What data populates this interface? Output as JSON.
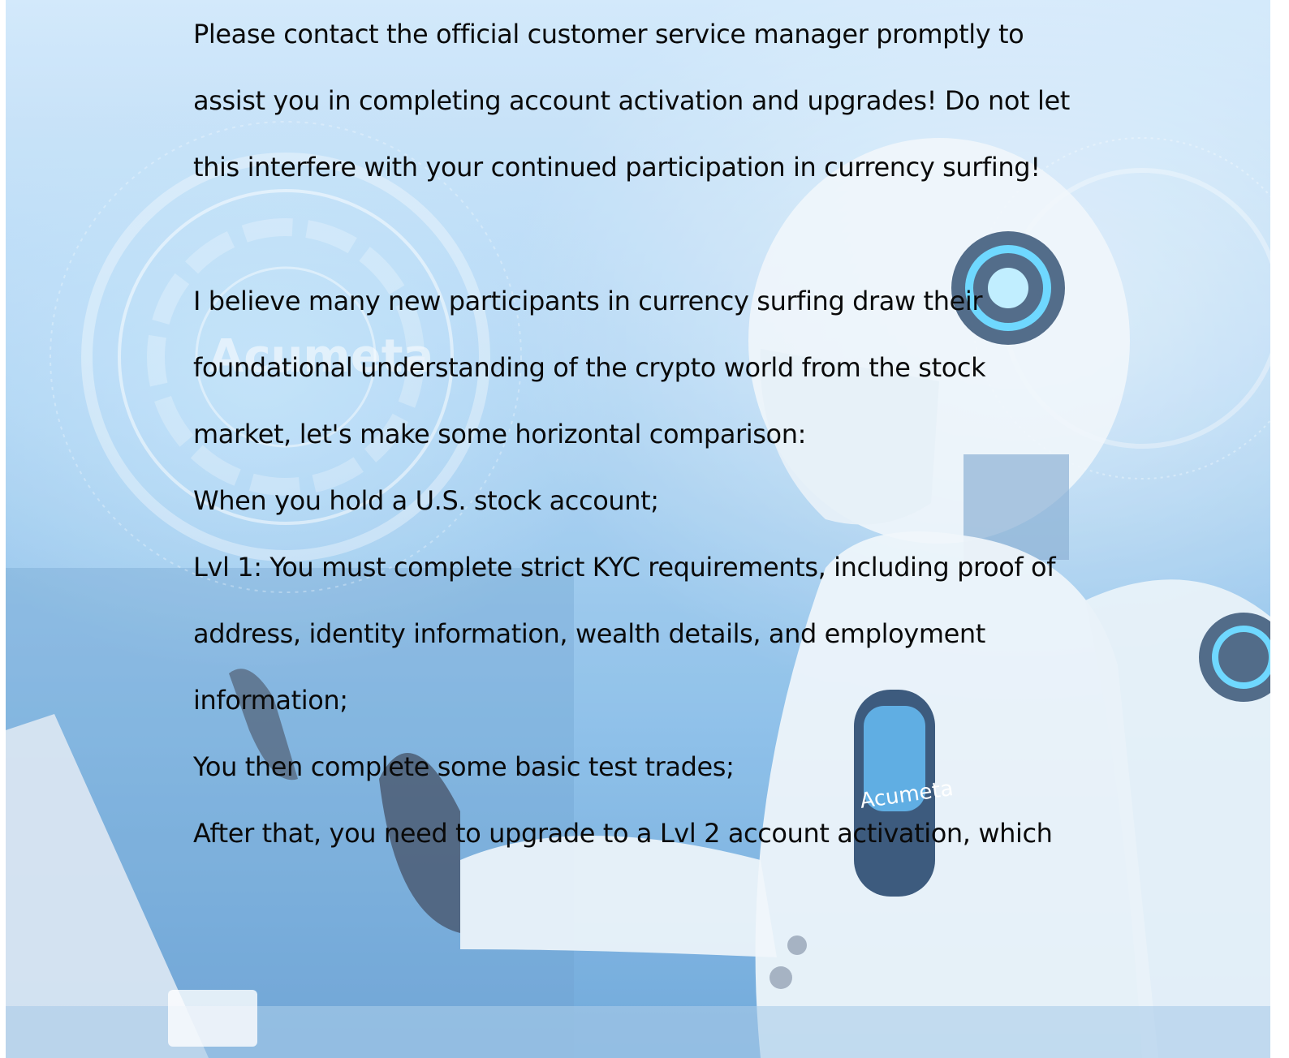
{
  "background": {
    "description_icon": "ai-robot-illustration-icon",
    "watermark_logo_text": "Acumeta",
    "chest_badge_text": "Acumeta",
    "colors": {
      "sky_top": "#cde6fb",
      "sky_bottom": "#5f9ed6",
      "robot_white": "#eef5fb",
      "glow": "#3fb6f0"
    }
  },
  "content": {
    "lines": [
      "Please contact the official customer service manager promptly to",
      "assist you in completing account activation and upgrades! Do not let",
      "this interfere with your continued participation in currency surfing!",
      "I believe many new participants in currency surfing draw their",
      "foundational understanding of the crypto world from the stock",
      "market, let's make some horizontal comparison:",
      "When you hold a U.S. stock account;",
      "Lvl 1: You must complete strict KYC requirements, including proof of",
      "address, identity information, wealth details, and employment",
      "information;",
      "You then complete some basic test trades;",
      "After that, you need to upgrade to a Lvl 2 account activation, which"
    ]
  }
}
